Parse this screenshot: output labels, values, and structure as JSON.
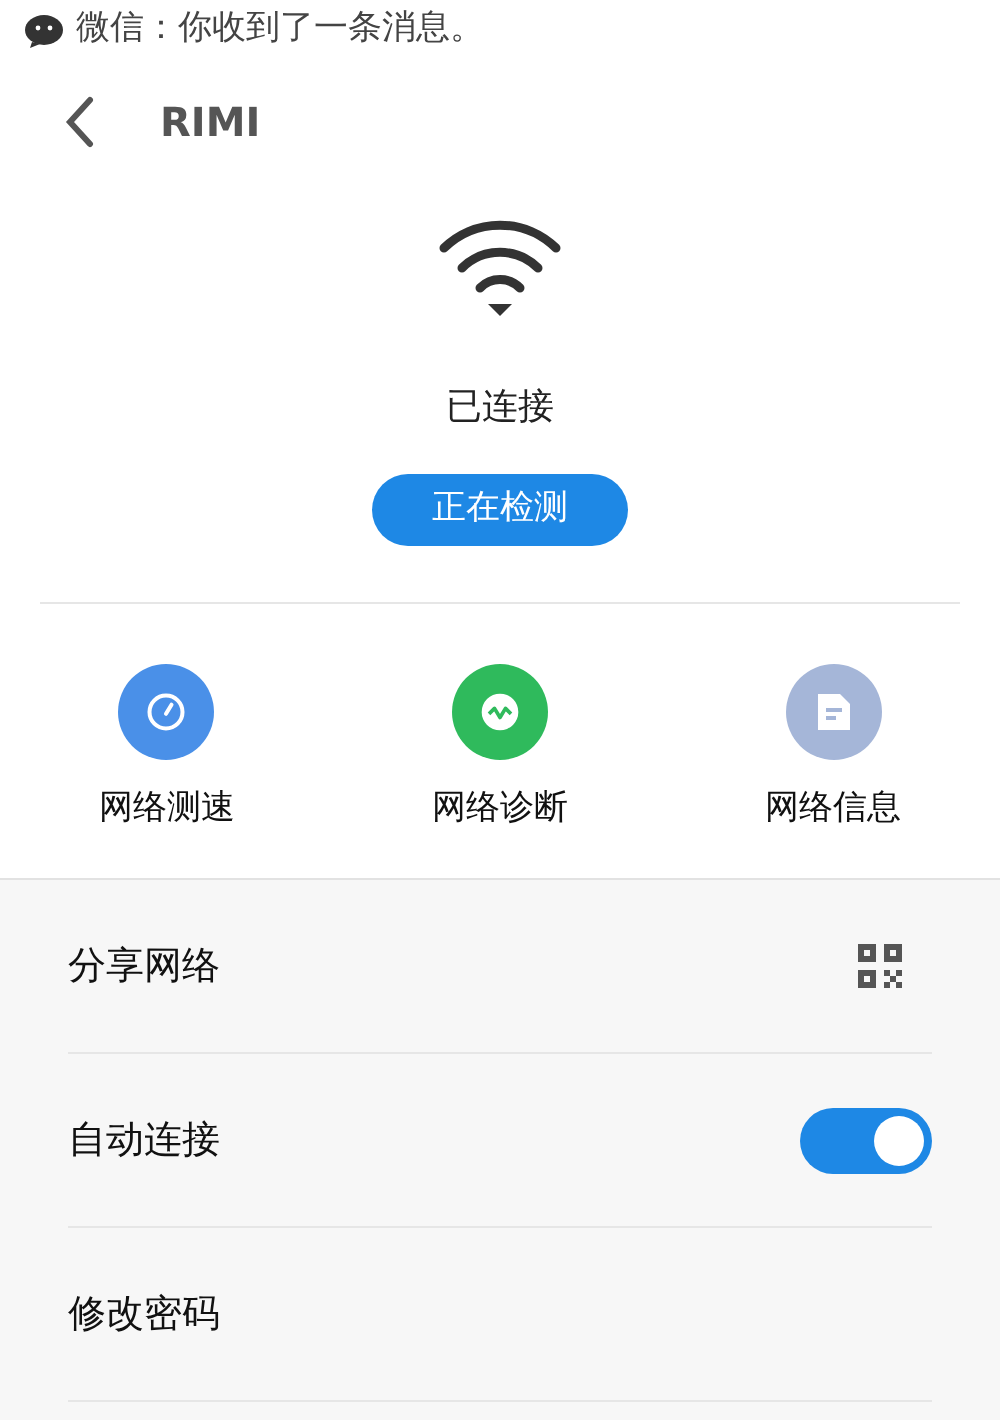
{
  "notification": {
    "text": "微信：你收到了一条消息。"
  },
  "header": {
    "title": "RIMI"
  },
  "status": {
    "label": "已连接",
    "button": "正在检测"
  },
  "actions": [
    {
      "label": "网络测速",
      "kind": "speed",
      "color": "#4a90e8"
    },
    {
      "label": "网络诊断",
      "kind": "diagnose",
      "color": "#2fba5c"
    },
    {
      "label": "网络信息",
      "kind": "info",
      "color": "#a5b6d8"
    }
  ],
  "settings": [
    {
      "label": "分享网络",
      "kind": "qr"
    },
    {
      "label": "自动连接",
      "kind": "toggle",
      "on": true
    },
    {
      "label": "修改密码",
      "kind": "plain"
    }
  ]
}
